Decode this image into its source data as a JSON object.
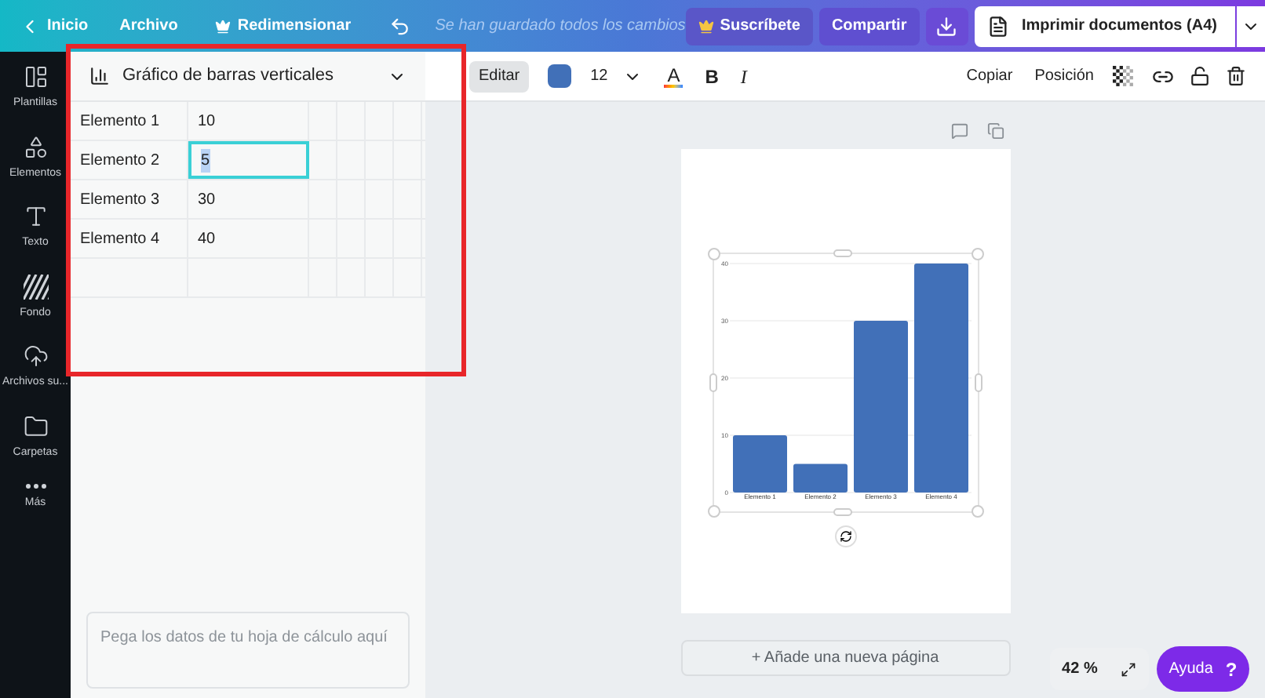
{
  "topbar": {
    "home": "Inicio",
    "file": "Archivo",
    "resize": "Redimensionar",
    "status": "Se han guardado todos los cambios",
    "subscribe": "Suscríbete",
    "share": "Compartir",
    "print": "Imprimir documentos (A4)"
  },
  "sidebar": {
    "items": [
      {
        "label": "Plantillas"
      },
      {
        "label": "Elementos"
      },
      {
        "label": "Texto"
      },
      {
        "label": "Fondo"
      },
      {
        "label": "Archivos su..."
      },
      {
        "label": "Carpetas"
      },
      {
        "label": "Más"
      }
    ]
  },
  "panel": {
    "chart_type": "Gráfico de barras verticales",
    "rows": [
      {
        "label": "Elemento 1",
        "value": "10",
        "selected": false
      },
      {
        "label": "Elemento 2",
        "value": "5",
        "selected": true
      },
      {
        "label": "Elemento 3",
        "value": "30",
        "selected": false
      },
      {
        "label": "Elemento 4",
        "value": "40",
        "selected": false
      }
    ],
    "paste_placeholder": "Pega los datos de tu hoja de cálculo aquí"
  },
  "toolbar": {
    "edit": {
      "label": "Editar",
      "selected": true
    },
    "color": "#4170b8",
    "font_size": "12",
    "text_color_glyph": "A",
    "bold": "B",
    "italic": "I",
    "copy": "Copiar",
    "position": "Posición"
  },
  "canvas": {
    "chart_data": {
      "type": "bar",
      "categories": [
        "Elemento 1",
        "Elemento 2",
        "Elemento 3",
        "Elemento 4"
      ],
      "series": [
        {
          "color": "#4170b8",
          "values": [
            10,
            5,
            30,
            40
          ]
        }
      ],
      "ylim": [
        0,
        40
      ],
      "yticks": [
        0,
        10,
        20,
        30,
        40
      ],
      "grid": true
    },
    "add_page": "+ Añade una nueva página",
    "zoom": "42 %",
    "help": "Ayuda",
    "help_glyph": "?"
  }
}
